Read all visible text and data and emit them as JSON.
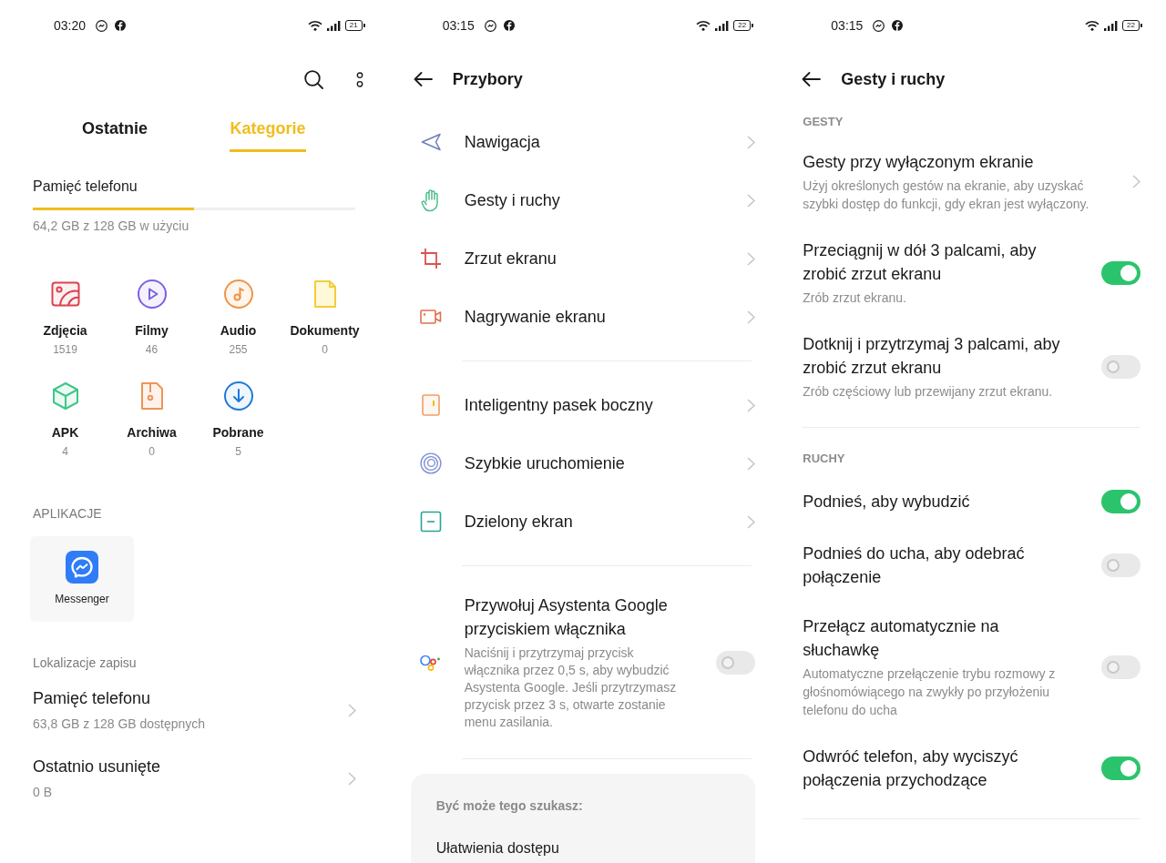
{
  "screens": [
    {
      "kind": "file_manager",
      "status_bar": {
        "time": "03:20",
        "battery": "21"
      },
      "tabs": [
        {
          "label": "Ostatnie",
          "selected": false
        },
        {
          "label": "Kategorie",
          "selected": true
        }
      ],
      "storage": {
        "title": "Pamięć telefonu",
        "level": 0.5,
        "usage": "64,2 GB z 128 GB w użyciu"
      },
      "categories": [
        {
          "kind": "photos",
          "label": "Zdjęcia",
          "count": "1519"
        },
        {
          "kind": "videos",
          "label": "Filmy",
          "count": "46"
        },
        {
          "kind": "audio",
          "label": "Audio",
          "count": "255"
        },
        {
          "kind": "documents",
          "label": "Dokumenty",
          "count": "0"
        },
        {
          "kind": "apk",
          "label": "APK",
          "count": "4"
        },
        {
          "kind": "archives",
          "label": "Archiwa",
          "count": "0"
        },
        {
          "kind": "downloads",
          "label": "Pobrane",
          "count": "5"
        }
      ],
      "apps": {
        "heading": "APLIKACJE",
        "items": [
          {
            "kind": "messenger",
            "label": "Messenger"
          }
        ]
      },
      "locations": {
        "heading": "Lokalizacje zapisu",
        "items": [
          {
            "title": "Pamięć telefonu",
            "detail": "63,8 GB z 128 GB dostępnych"
          },
          {
            "title": "Ostatnio usunięte",
            "detail": "0 B"
          }
        ]
      }
    },
    {
      "kind": "tools",
      "status_bar": {
        "time": "03:15",
        "battery": "22"
      },
      "title": "Przybory",
      "groups": [
        {
          "items": [
            {
              "kind": "navigation",
              "label": "Nawigacja"
            },
            {
              "kind": "gestures",
              "label": "Gesty i ruchy"
            },
            {
              "kind": "screenshot",
              "label": "Zrzut ekranu"
            },
            {
              "kind": "screen_recording",
              "label": "Nagrywanie ekranu"
            }
          ]
        },
        {
          "items": [
            {
              "kind": "smart_sidebar",
              "label": "Inteligentny pasek boczny"
            },
            {
              "kind": "quick_launch",
              "label": "Szybkie uruchomienie"
            },
            {
              "kind": "split_screen",
              "label": "Dzielony ekran"
            }
          ]
        },
        {
          "items": [
            {
              "kind": "assistant",
              "label": "Przywołuj Asystenta Google przyciskiem włącznika",
              "description": "Naciśnij i przytrzymaj przycisk włącznika przez 0,5 s, aby wybudzić Asystenta Google. Jeśli przytrzymasz przycisk przez 3 s, otwarte zostanie menu zasilania.",
              "on": false
            }
          ]
        }
      ],
      "suggestions": {
        "heading": "Być może tego szukasz:",
        "items": [
          "Ułatwienia dostępu"
        ]
      }
    },
    {
      "kind": "gestures",
      "status_bar": {
        "time": "03:15",
        "battery": "22"
      },
      "title": "Gesty i ruchy",
      "sections": [
        {
          "heading": "GESTY",
          "items": [
            {
              "kind": "link",
              "title": "Gesty przy wyłączonym ekranie",
              "description": "Użyj określonych gestów na ekranie, aby uzyskać szybki dostęp do funkcji, gdy ekran jest wyłączony."
            },
            {
              "kind": "switch",
              "title": "Przeciągnij w dół 3 palcami, aby zrobić zrzut ekranu",
              "description": "Zrób zrzut ekranu.",
              "on": true
            },
            {
              "kind": "switch",
              "title": "Dotknij i przytrzymaj 3 palcami, aby zrobić zrzut ekranu",
              "description": "Zrób częściowy lub przewijany zrzut ekranu.",
              "on": false
            }
          ]
        },
        {
          "heading": "RUCHY",
          "items": [
            {
              "kind": "switch",
              "title": "Podnieś, aby wybudzić",
              "on": true
            },
            {
              "kind": "switch",
              "title": "Podnieś do ucha, aby odebrać połączenie",
              "on": false
            },
            {
              "kind": "switch",
              "title": "Przełącz automatycznie na słuchawkę",
              "description": "Automatyczne przełączenie trybu rozmowy z głośnomówiącego na zwykły po przyłożeniu telefonu do ucha",
              "on": false
            },
            {
              "kind": "switch",
              "title": "Odwróć telefon, aby wyciszyć połączenia przychodzące",
              "on": true
            }
          ]
        }
      ]
    }
  ]
}
